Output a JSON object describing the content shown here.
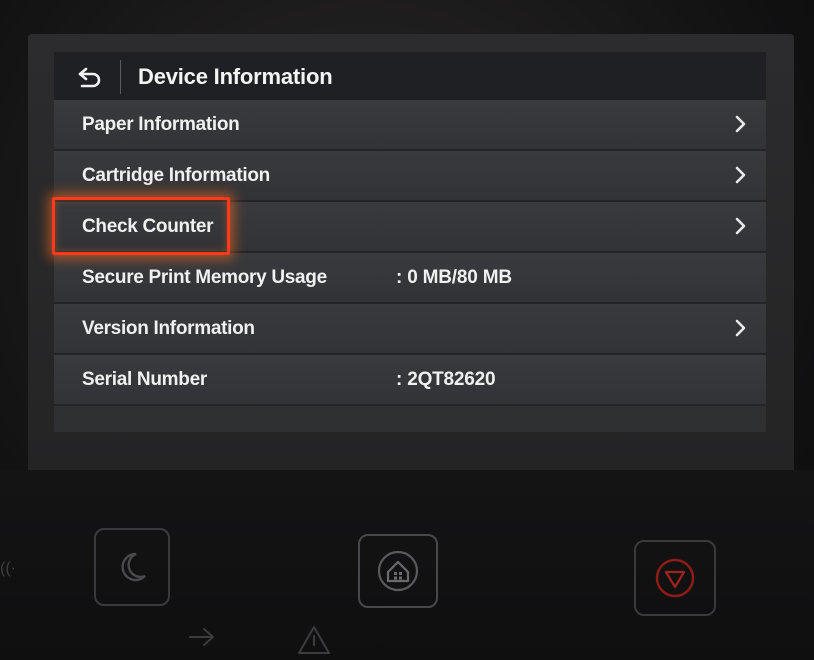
{
  "header": {
    "title": "Device Information",
    "back_icon": "back-arrow-icon"
  },
  "rows": [
    {
      "label": "Paper Information",
      "value": "",
      "has_chevron": true
    },
    {
      "label": "Cartridge Information",
      "value": "",
      "has_chevron": true
    },
    {
      "label": "Check Counter",
      "value": "",
      "has_chevron": true,
      "highlighted": true
    },
    {
      "label": "Secure Print Memory Usage",
      "value": ": 0 MB/80 MB",
      "has_chevron": false
    },
    {
      "label": "Version Information",
      "value": "",
      "has_chevron": true
    },
    {
      "label": "Serial Number",
      "value": ": 2QT82620",
      "has_chevron": false
    }
  ],
  "hardware_buttons": [
    {
      "name": "sleep",
      "icon": "moon-icon"
    },
    {
      "name": "home",
      "icon": "home-icon"
    },
    {
      "name": "stop",
      "icon": "stop-icon"
    }
  ],
  "colors": {
    "highlight": "#ff3a1c",
    "stop_button": "#b3201a"
  }
}
